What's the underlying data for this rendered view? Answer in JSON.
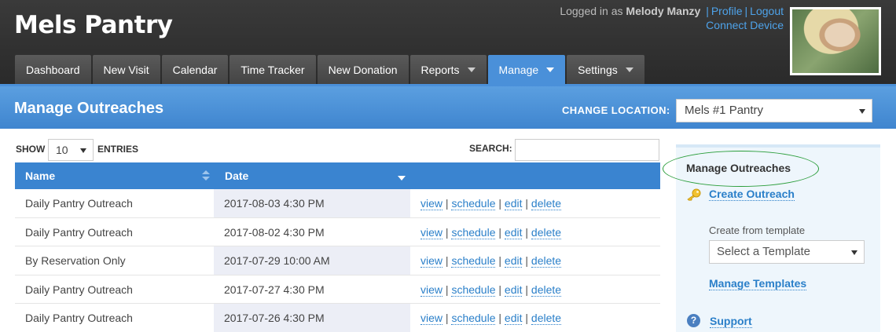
{
  "app": {
    "title": "Mels Pantry"
  },
  "user": {
    "logged_in_prefix": "Logged in as",
    "name": "Melody Manzy",
    "profile_link": "Profile",
    "logout_link": "Logout",
    "connect_link": "Connect Device"
  },
  "nav": {
    "tabs": [
      {
        "label": "Dashboard"
      },
      {
        "label": "New Visit"
      },
      {
        "label": "Calendar"
      },
      {
        "label": "Time Tracker"
      },
      {
        "label": "New Donation"
      },
      {
        "label": "Reports"
      },
      {
        "label": "Manage"
      },
      {
        "label": "Settings"
      }
    ],
    "active": "Manage"
  },
  "page": {
    "title": "Manage Outreaches",
    "location_label": "CHANGE LOCATION:",
    "location_value": "Mels #1 Pantry"
  },
  "table_controls": {
    "show_label": "SHOW",
    "entries_value": "10",
    "entries_label": "ENTRIES",
    "search_label": "SEARCH:"
  },
  "table": {
    "columns": [
      "Name",
      "Date"
    ],
    "rows": [
      {
        "name": "Daily Pantry Outreach",
        "date": "2017-08-03 4:30 PM"
      },
      {
        "name": "Daily Pantry Outreach",
        "date": "2017-08-02 4:30 PM"
      },
      {
        "name": "By Reservation Only",
        "date": "2017-07-29 10:00 AM"
      },
      {
        "name": "Daily Pantry Outreach",
        "date": "2017-07-27 4:30 PM"
      },
      {
        "name": "Daily Pantry Outreach",
        "date": "2017-07-26 4:30 PM"
      }
    ],
    "actions": {
      "view": "view",
      "schedule": "schedule",
      "edit": "edit",
      "delete": "delete",
      "separator": "|"
    }
  },
  "sidebar": {
    "title": "Manage Outreaches",
    "create_link": "Create Outreach",
    "template_label": "Create from template",
    "template_placeholder": "Select a Template",
    "manage_templates_link": "Manage Templates",
    "support_link": "Support"
  },
  "colors": {
    "header_bg": "#2f2f2f",
    "accent": "#4a90d9",
    "link": "#2a7fc9",
    "highlight_oval": "#2a9d3a"
  }
}
